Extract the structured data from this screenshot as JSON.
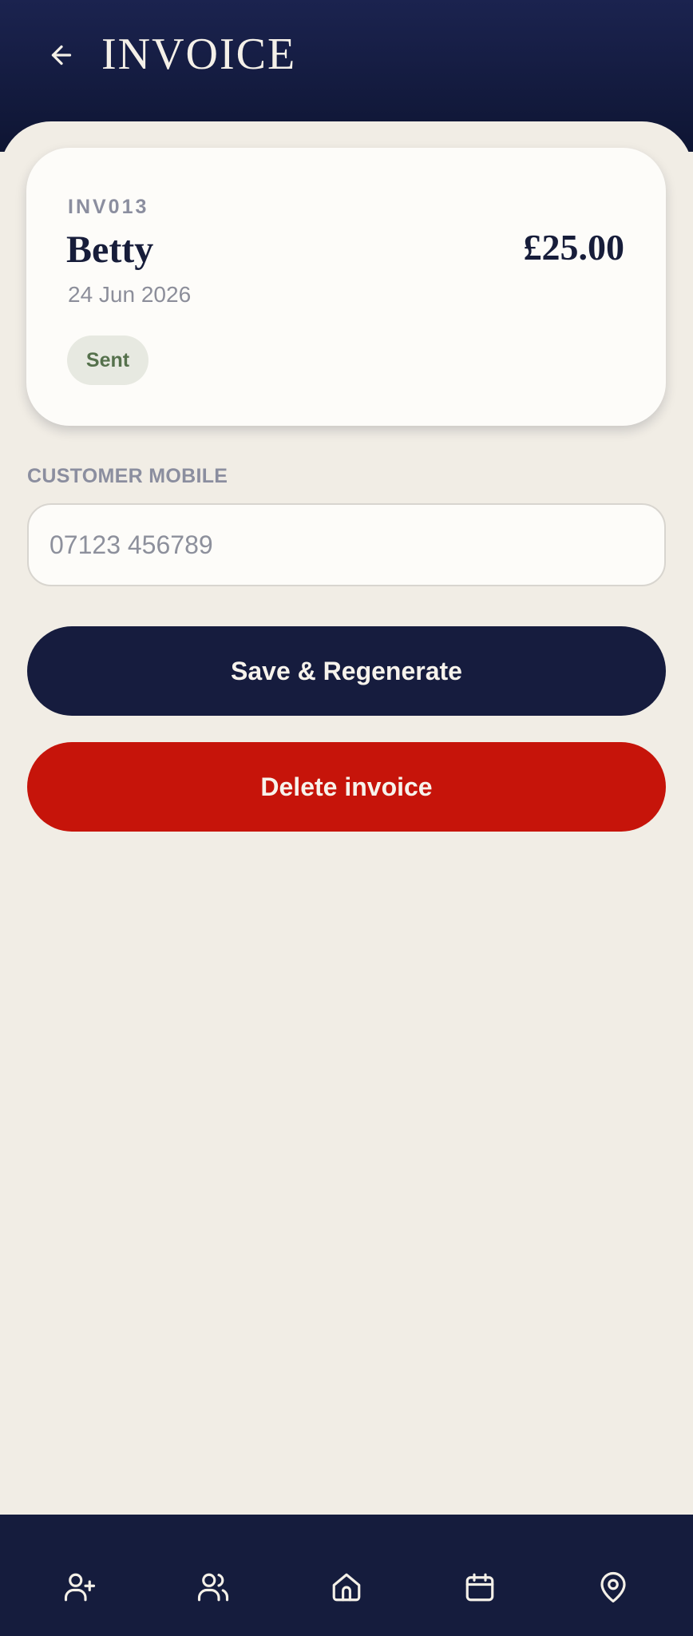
{
  "header": {
    "title": "INVOICE",
    "back_icon": "arrow-left-icon"
  },
  "invoice": {
    "number": "INV013",
    "customer_name": "Betty",
    "date": "24 Jun 2026",
    "amount": "£25.00",
    "status": "Sent"
  },
  "mobile_field": {
    "label": "CUSTOMER MOBILE",
    "placeholder": "07123 456789",
    "value": ""
  },
  "actions": {
    "save_label": "Save & Regenerate",
    "delete_label": "Delete invoice"
  },
  "bottom_nav": {
    "items": [
      {
        "icon": "add-user-icon"
      },
      {
        "icon": "users-icon"
      },
      {
        "icon": "home-icon"
      },
      {
        "icon": "calendar-icon"
      },
      {
        "icon": "map-pin-icon"
      }
    ]
  },
  "colors": {
    "header_bg": "#161c3e",
    "page_bg": "#f1ede5",
    "card_bg": "#fdfcf9",
    "primary": "#161c3e",
    "danger": "#c6140a",
    "status_sent_bg": "#e7e9e1",
    "status_sent_text": "#55714c"
  }
}
